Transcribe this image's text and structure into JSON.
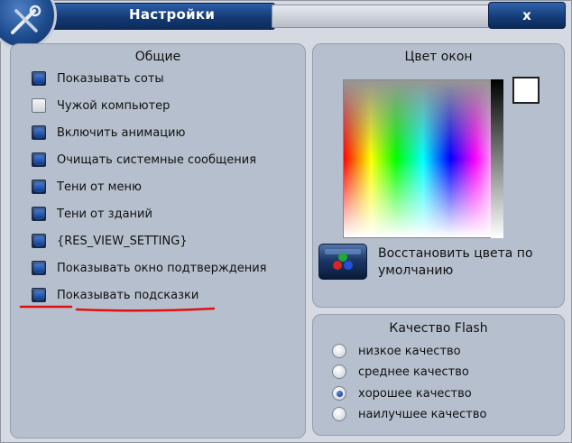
{
  "window": {
    "title": "Настройки",
    "close_label": "x"
  },
  "general": {
    "title": "Общие",
    "options": [
      {
        "label": "Показывать соты",
        "checked": true
      },
      {
        "label": "Чужой компьютер",
        "checked": false
      },
      {
        "label": "Включить анимацию",
        "checked": true
      },
      {
        "label": "Очищать системные сообщения",
        "checked": true
      },
      {
        "label": "Тени от меню",
        "checked": true
      },
      {
        "label": "Тени от зданий",
        "checked": true
      },
      {
        "label": "{RES_VIEW_SETTING}",
        "checked": true
      },
      {
        "label": "Показывать окно подтверждения",
        "checked": true
      },
      {
        "label": "Показывать подсказки",
        "checked": true
      }
    ]
  },
  "colors": {
    "title": "Цвет окон",
    "selected_color": "#ffffff",
    "restore_label": "Восстановить цвета по умолчанию",
    "restore_icon": "rgb-dots-icon"
  },
  "flash": {
    "title": "Качество Flash",
    "options": [
      {
        "label": "низкое качество",
        "selected": false
      },
      {
        "label": "среднее качество",
        "selected": false
      },
      {
        "label": "хорошее качество",
        "selected": true
      },
      {
        "label": "наилучшее качество",
        "selected": false
      }
    ]
  },
  "annotation": {
    "color": "#e01010"
  }
}
